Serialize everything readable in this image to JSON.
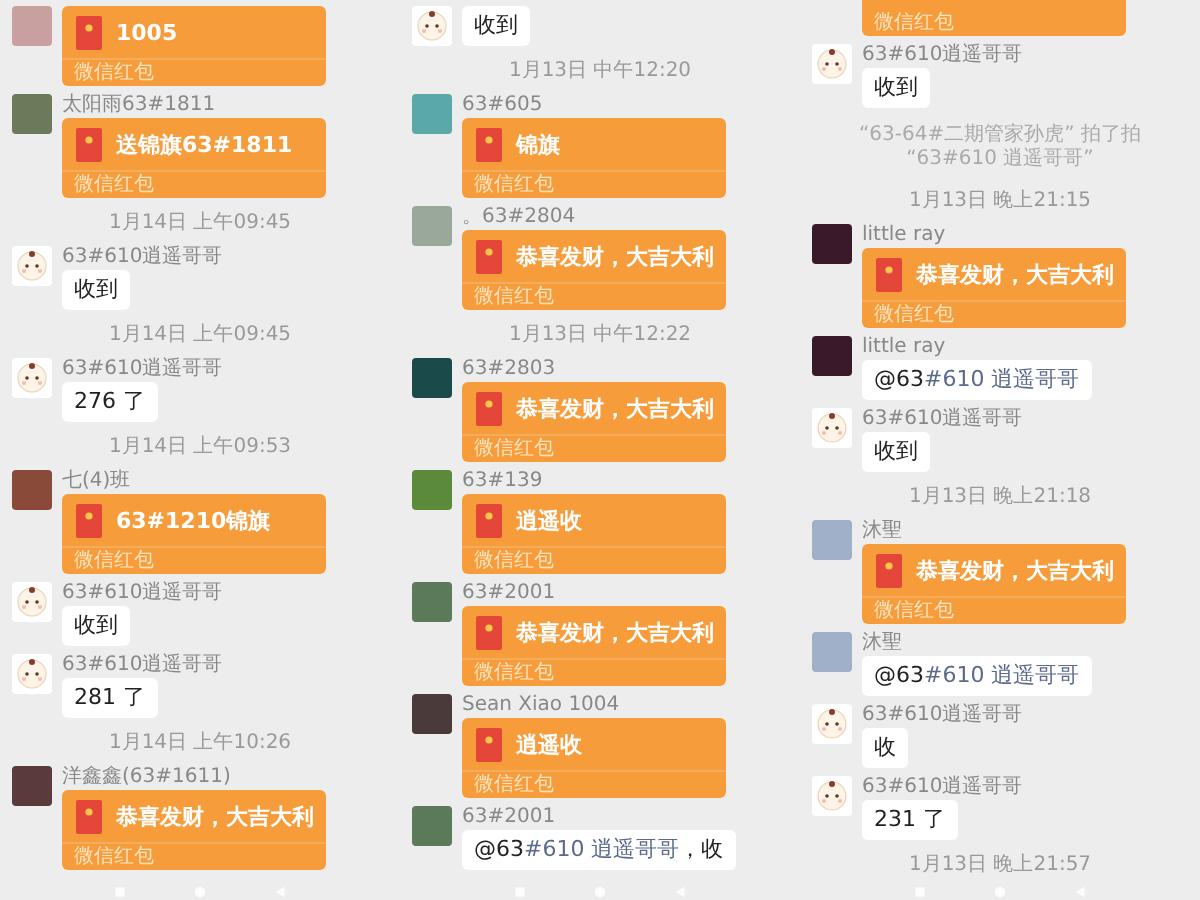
{
  "columns": [
    {
      "items": [
        {
          "kind": "packet",
          "avatar": {
            "kind": "photo",
            "color": "#c9a0a0"
          },
          "title": "1005",
          "footer": "微信红包"
        },
        {
          "kind": "packet",
          "name": "太阳雨63#1811",
          "avatar": {
            "kind": "photo",
            "color": "#6a7a5a"
          },
          "title": "送锦旗63#1811",
          "footer": "微信红包"
        },
        {
          "kind": "time",
          "text": "1月14日 上午09:45"
        },
        {
          "kind": "text",
          "name": "63#610逍遥哥哥",
          "avatar": {
            "kind": "baby"
          },
          "text": "收到"
        },
        {
          "kind": "time",
          "text": "1月14日 上午09:45"
        },
        {
          "kind": "text",
          "name": "63#610逍遥哥哥",
          "avatar": {
            "kind": "baby"
          },
          "text": "276 了"
        },
        {
          "kind": "time",
          "text": "1月14日 上午09:53"
        },
        {
          "kind": "packet",
          "name": "七(4)班",
          "avatar": {
            "kind": "photo",
            "color": "#8a4a3a"
          },
          "title": "63#1210锦旗",
          "footer": "微信红包"
        },
        {
          "kind": "text",
          "name": "63#610逍遥哥哥",
          "avatar": {
            "kind": "baby"
          },
          "text": "收到"
        },
        {
          "kind": "text",
          "name": "63#610逍遥哥哥",
          "avatar": {
            "kind": "baby"
          },
          "text": "281 了"
        },
        {
          "kind": "time",
          "text": "1月14日 上午10:26"
        },
        {
          "kind": "packet",
          "name": "洋鑫鑫(63#1611)",
          "avatar": {
            "kind": "photo",
            "color": "#5a3a3a"
          },
          "title": "恭喜发财，大吉大利",
          "footer": "微信红包"
        }
      ]
    },
    {
      "items": [
        {
          "kind": "text",
          "avatar": {
            "kind": "baby"
          },
          "text": "收到"
        },
        {
          "kind": "time",
          "text": "1月13日 中午12:20"
        },
        {
          "kind": "packet",
          "name": "63#605",
          "avatar": {
            "kind": "photo",
            "color": "#5aa8a8"
          },
          "title": "锦旗",
          "footer": "微信红包"
        },
        {
          "kind": "packet",
          "name": "。63#2804",
          "avatar": {
            "kind": "photo",
            "color": "#9aa89a"
          },
          "title": "恭喜发财，大吉大利",
          "footer": "微信红包"
        },
        {
          "kind": "time",
          "text": "1月13日 中午12:22"
        },
        {
          "kind": "packet",
          "name": "63#2803",
          "avatar": {
            "kind": "photo",
            "color": "#1a4a4a"
          },
          "title": "恭喜发财，大吉大利",
          "footer": "微信红包"
        },
        {
          "kind": "packet",
          "name": "63#139",
          "avatar": {
            "kind": "photo",
            "color": "#5a8a3a"
          },
          "title": "逍遥收",
          "footer": "微信红包"
        },
        {
          "kind": "packet",
          "name": "63#2001",
          "avatar": {
            "kind": "photo",
            "color": "#5a7a5a"
          },
          "title": "恭喜发财，大吉大利",
          "footer": "微信红包"
        },
        {
          "kind": "packet",
          "name": "Sean Xiao 1004",
          "avatar": {
            "kind": "photo",
            "color": "#4a3a3a"
          },
          "title": "逍遥收",
          "footer": "微信红包"
        },
        {
          "kind": "mention",
          "name": "63#2001",
          "avatar": {
            "kind": "photo",
            "color": "#5a7a5a"
          },
          "prefix": "@63",
          "mention": "#610 逍遥哥哥",
          "suffix": "，收"
        }
      ]
    },
    {
      "items": [
        {
          "kind": "packet_tail",
          "footer": "微信红包"
        },
        {
          "kind": "text",
          "name": "63#610逍遥哥哥",
          "avatar": {
            "kind": "baby"
          },
          "text": "收到"
        },
        {
          "kind": "system",
          "text": "“63-64#二期管家孙虎” 拍了拍 “63#610 逍遥哥哥”"
        },
        {
          "kind": "time",
          "text": "1月13日 晚上21:15"
        },
        {
          "kind": "packet",
          "name": "little ray",
          "avatar": {
            "kind": "photo",
            "color": "#3a1a2a"
          },
          "title": "恭喜发财，大吉大利",
          "footer": "微信红包"
        },
        {
          "kind": "mention",
          "name": "little ray",
          "avatar": {
            "kind": "photo",
            "color": "#3a1a2a"
          },
          "prefix": "@63",
          "mention": "#610 逍遥哥哥"
        },
        {
          "kind": "text",
          "name": "63#610逍遥哥哥",
          "avatar": {
            "kind": "baby"
          },
          "text": "收到"
        },
        {
          "kind": "time",
          "text": "1月13日 晚上21:18"
        },
        {
          "kind": "packet",
          "name": "沐聖",
          "avatar": {
            "kind": "photo",
            "color": "#a0b0c8"
          },
          "title": "恭喜发财，大吉大利",
          "footer": "微信红包"
        },
        {
          "kind": "mention",
          "name": "沐聖",
          "avatar": {
            "kind": "photo",
            "color": "#a0b0c8"
          },
          "prefix": "@63",
          "mention": "#610 逍遥哥哥"
        },
        {
          "kind": "text",
          "name": "63#610逍遥哥哥",
          "avatar": {
            "kind": "baby"
          },
          "text": "收"
        },
        {
          "kind": "text",
          "name": "63#610逍遥哥哥",
          "avatar": {
            "kind": "baby"
          },
          "text": "231 了"
        },
        {
          "kind": "time",
          "text": "1月13日 晚上21:57"
        }
      ]
    }
  ]
}
